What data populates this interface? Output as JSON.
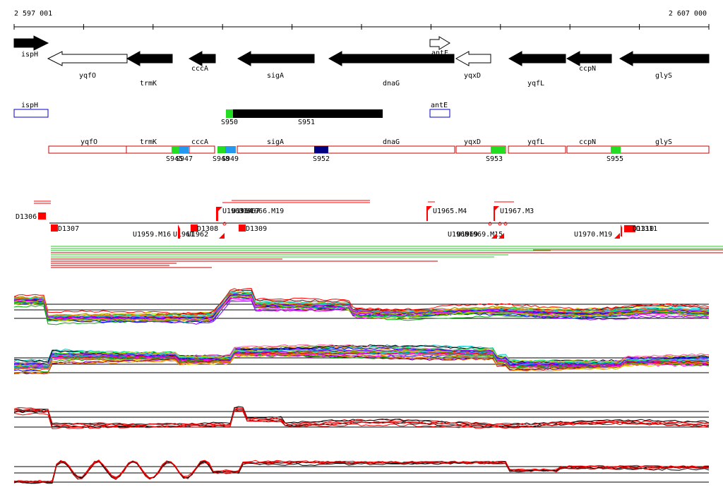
{
  "axis": {
    "start_label": "2 597 001",
    "end_label": "2 607 000"
  },
  "genes": [
    {
      "label": "ispH",
      "strand": "+",
      "filled": true
    },
    {
      "label": "yqfO",
      "strand": "-",
      "filled": false
    },
    {
      "label": "trmK",
      "strand": "-",
      "filled": true
    },
    {
      "label": "cccA",
      "strand": "-",
      "filled": true
    },
    {
      "label": "sigA",
      "strand": "-",
      "filled": true
    },
    {
      "label": "dnaG",
      "strand": "-",
      "filled": true
    },
    {
      "label": "antE",
      "strand": "+",
      "filled": false
    },
    {
      "label": "yqxD",
      "strand": "-",
      "filled": false
    },
    {
      "label": "yqfL",
      "strand": "-",
      "filled": true
    },
    {
      "label": "ccpN",
      "strand": "-",
      "filled": true
    },
    {
      "label": "glyS",
      "strand": "-",
      "filled": true
    }
  ],
  "operons_plus": {
    "boxes": [
      "ispH",
      "antE"
    ],
    "segments": [
      "S950",
      "S951"
    ]
  },
  "operons_minus": {
    "boxes": [
      "yqfO",
      "trmK",
      "cccA",
      "sigA",
      "dnaG",
      "yqxD",
      "yqfL",
      "ccpN",
      "glyS"
    ],
    "segments": [
      "S945",
      "S947",
      "S948",
      "S949",
      "S952",
      "S953",
      "S955"
    ]
  },
  "transcription_units": [
    "D1306",
    "D1307",
    "U1959.M16",
    "U1961",
    "U1962",
    "D1308",
    "U1963",
    "U1964",
    "U1967",
    "U1966.M19",
    "D1309",
    "U1965.M4",
    "U1967.M3",
    "U1968",
    "U1969",
    "U1969.M15",
    "U1970.M19",
    "D1310",
    "D1311"
  ],
  "colors": {
    "gene_fill": "#000000",
    "operon_plus_box": "#0000cc",
    "operon_minus_box": "#cc0000",
    "segment_green": "#22dd22",
    "segment_blue": "#2299ee",
    "segment_navy": "#000080",
    "tu_red": "#ff0000",
    "reads_green": "#22cc22",
    "reads_red": "#cc0000"
  },
  "expression_panels": [
    {
      "name": "plus-strand-tiling",
      "series_count": 40,
      "style": "multicolor"
    },
    {
      "name": "minus-strand-tiling",
      "series_count": 40,
      "style": "multicolor"
    },
    {
      "name": "plus-strand-summary",
      "series_count": 6,
      "style": "black-red"
    },
    {
      "name": "minus-strand-summary",
      "series_count": 6,
      "style": "black-red"
    }
  ]
}
